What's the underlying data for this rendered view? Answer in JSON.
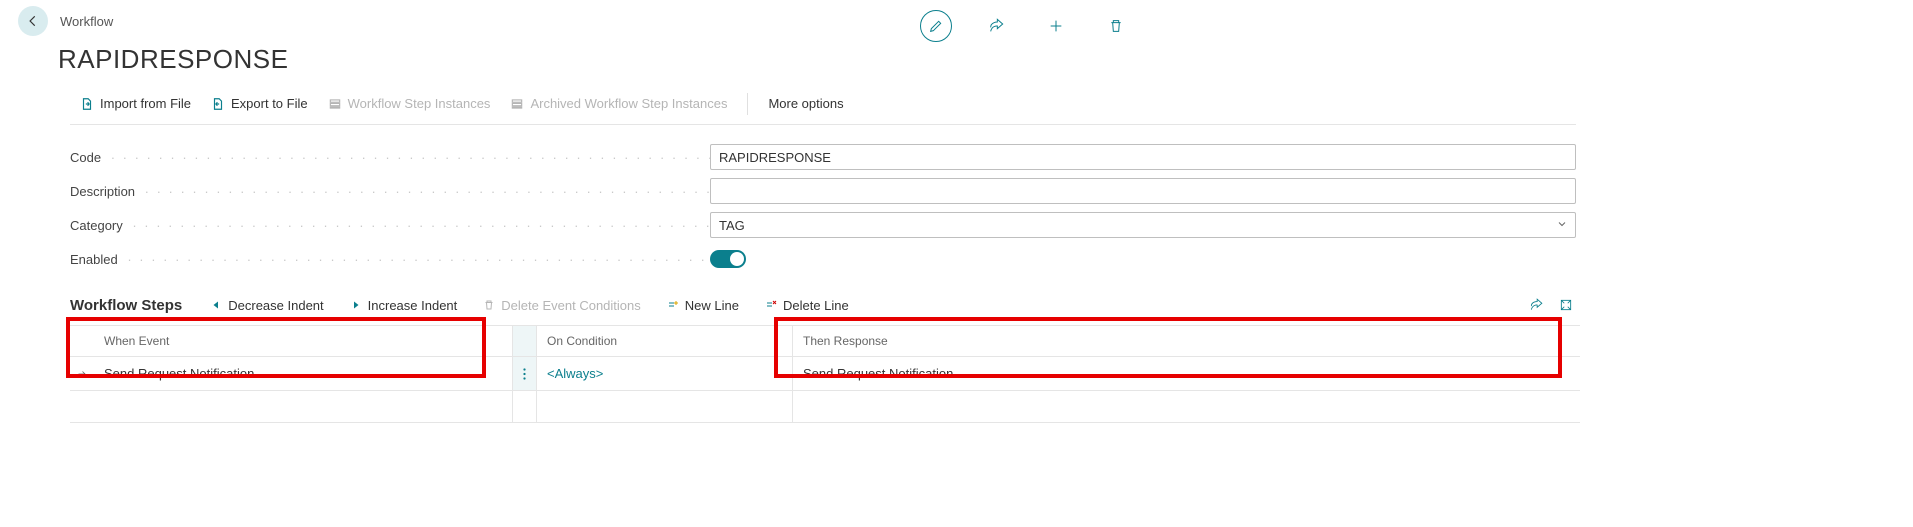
{
  "breadcrumb": "Workflow",
  "title": "RAPIDRESPONSE",
  "toolbar": {
    "import": "Import from File",
    "export": "Export to File",
    "instances": "Workflow Step Instances",
    "archived": "Archived Workflow Step Instances",
    "more": "More options"
  },
  "labels": {
    "code": "Code",
    "description": "Description",
    "category": "Category",
    "enabled": "Enabled"
  },
  "values": {
    "code": "RAPIDRESPONSE",
    "description": "",
    "category": "TAG"
  },
  "section": {
    "title": "Workflow Steps",
    "dec": "Decrease Indent",
    "inc": "Increase Indent",
    "delcond": "Delete Event Conditions",
    "newline": "New Line",
    "delline": "Delete Line"
  },
  "grid": {
    "head": {
      "event": "When Event",
      "cond": "On Condition",
      "resp": "Then Response"
    },
    "row": {
      "event": "Send Request Notification",
      "cond": "<Always>",
      "resp": "Send Request Notification"
    }
  }
}
